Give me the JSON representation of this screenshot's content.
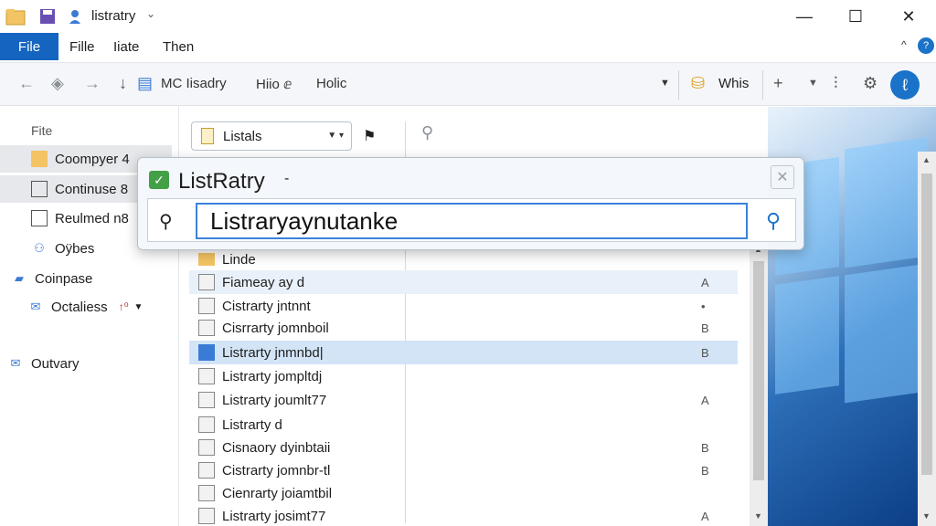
{
  "window": {
    "title": "listratry",
    "controls": {
      "minimize": "—",
      "maximize": "☐",
      "close": "✕"
    }
  },
  "menu": {
    "items": [
      "File",
      "Fille",
      "Iiate",
      "Then"
    ],
    "help_chevron": "^"
  },
  "toolbar": {
    "address_parts": [
      "MC Iisadry",
      "Hiio ⅇ",
      "Holic"
    ],
    "search_label": "Whis"
  },
  "nav": {
    "header": "Fite",
    "items": [
      {
        "label": "Coompyer 4",
        "icon": "folder-icon",
        "selected": true
      },
      {
        "label": "Continuse 8",
        "icon": "document-icon",
        "selected": true
      },
      {
        "label": "Reulmed n8",
        "icon": "document-icon",
        "selected": false
      },
      {
        "label": "Oÿbes",
        "icon": "people-icon",
        "selected": false
      },
      {
        "label": "Coinpase",
        "icon": "folder-blue-icon",
        "selected": false
      },
      {
        "label": "Octaliess",
        "icon": "mail-icon",
        "selected": false
      },
      {
        "label": "Outvary",
        "icon": "mail-icon",
        "selected": false
      }
    ],
    "octaliess_badge": "↑⁰"
  },
  "content": {
    "library_combo": "Listals",
    "rows": [
      {
        "name": "Linde",
        "flag": "",
        "icon": "folder"
      },
      {
        "name": "Fiameay ay d",
        "flag": "A",
        "icon": "doc"
      },
      {
        "name": "Cistrarty jntnnt",
        "flag": "•",
        "icon": "doc"
      },
      {
        "name": "Cisrrarty jomnboil",
        "flag": "B",
        "icon": "doc"
      },
      {
        "name": "Listrarty jnmnbd|",
        "flag": "B",
        "icon": "sel"
      },
      {
        "name": "Listrarty jompltdj",
        "flag": "",
        "icon": "doc"
      },
      {
        "name": "Listrarty joumlt77",
        "flag": "A",
        "icon": "doc"
      },
      {
        "name": "Listrarty d",
        "flag": "",
        "icon": "doc"
      },
      {
        "name": "Cisnaory dyinbtaii",
        "flag": "B",
        "icon": "doc"
      },
      {
        "name": "Cistrarty jomnbr-tl",
        "flag": "B",
        "icon": "doc"
      },
      {
        "name": "Cienrarty joiamtbil",
        "flag": "",
        "icon": "doc"
      },
      {
        "name": "Listrarty josimt77",
        "flag": "A",
        "icon": "doc"
      }
    ]
  },
  "popup": {
    "title": "ListRatry",
    "dash": "-",
    "input_value": "Listraryaynutanke"
  },
  "colors": {
    "accent": "#1565c0",
    "input_border": "#3b82d9",
    "check": "#43a047"
  }
}
